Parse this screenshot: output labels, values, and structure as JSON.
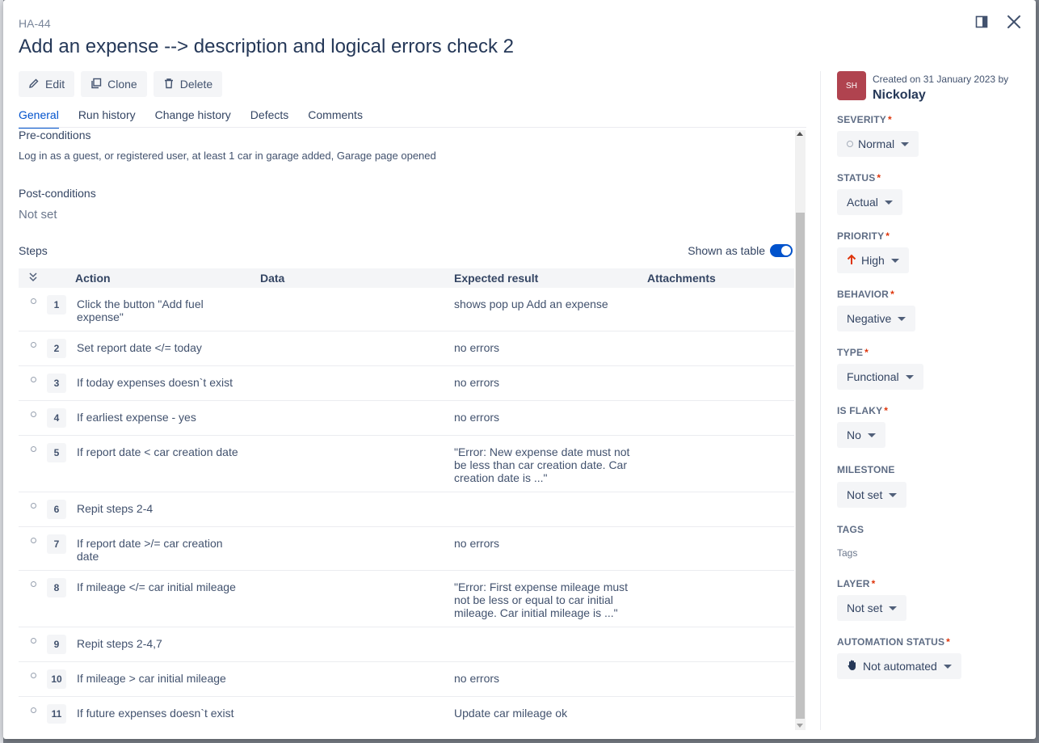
{
  "issue_key": "HA-44",
  "title": "Add an expense --> description and logical errors check 2",
  "toolbar": {
    "edit_label": "Edit",
    "clone_label": "Clone",
    "delete_label": "Delete"
  },
  "tabs": [
    {
      "label": "General",
      "active": true
    },
    {
      "label": "Run history",
      "active": false
    },
    {
      "label": "Change history",
      "active": false
    },
    {
      "label": "Defects",
      "active": false
    },
    {
      "label": "Comments",
      "active": false
    }
  ],
  "preconditions": {
    "label": "Pre-conditions",
    "text": "Log in as a guest, or registered user, at least 1 car in garage added, Garage page opened"
  },
  "postconditions": {
    "label": "Post-conditions",
    "value": "Not set"
  },
  "steps": {
    "label": "Steps",
    "toggle_label": "Shown as table",
    "toggle_on": true,
    "columns": {
      "action": "Action",
      "data": "Data",
      "expected": "Expected result",
      "attachments": "Attachments"
    },
    "rows": [
      {
        "num": "1",
        "action": "Click the button \"Add fuel expense\"",
        "data": "",
        "expected": "shows pop up Add an expense"
      },
      {
        "num": "2",
        "action": "Set report date </= today",
        "data": "",
        "expected": "no errors"
      },
      {
        "num": "3",
        "action": "If today expenses doesn`t exist",
        "data": "",
        "expected": "no errors"
      },
      {
        "num": "4",
        "action": "If earliest expense - yes",
        "data": "",
        "expected": "no errors"
      },
      {
        "num": "5",
        "action": "If report date < car creation date",
        "data": "",
        "expected": "\"Error: New expense date must not be less than car creation date. Car creation date is ...\""
      },
      {
        "num": "6",
        "action": "Repit steps 2-4",
        "data": "",
        "expected": ""
      },
      {
        "num": "7",
        "action": "If report date >/= car creation date",
        "data": "",
        "expected": "no errors"
      },
      {
        "num": "8",
        "action": "If mileage </= car initial mileage",
        "data": "",
        "expected": "\"Error: First expense mileage must not be less or equal to car initial mileage. Car initial mileage is ...\""
      },
      {
        "num": "9",
        "action": "Repit steps 2-4,7",
        "data": "",
        "expected": ""
      },
      {
        "num": "10",
        "action": "If mileage > car initial mileage",
        "data": "",
        "expected": "no errors"
      },
      {
        "num": "11",
        "action": "If future expenses doesn`t exist",
        "data": "",
        "expected": "Update car mileage ok"
      }
    ]
  },
  "sidebar": {
    "avatar_initials": "SH",
    "avatar_color": "#b0434f",
    "created_text": "Created on 31 January 2023 by",
    "author": "Nickolay",
    "severity": {
      "label": "SEVERITY",
      "required": "*",
      "value": "Normal"
    },
    "status": {
      "label": "STATUS",
      "required": "*",
      "value": "Actual"
    },
    "priority": {
      "label": "PRIORITY",
      "required": "*",
      "value": "High"
    },
    "behavior": {
      "label": "BEHAVIOR",
      "required": "*",
      "value": "Negative"
    },
    "type": {
      "label": "TYPE",
      "required": "*",
      "value": "Functional"
    },
    "is_flaky": {
      "label": "IS FLAKY",
      "required": "*",
      "value": "No"
    },
    "milestone": {
      "label": "MILESTONE",
      "value": "Not set"
    },
    "tags": {
      "label": "TAGS",
      "placeholder": "Tags"
    },
    "layer": {
      "label": "LAYER",
      "required": "*",
      "value": "Not set"
    },
    "automation_status": {
      "label": "AUTOMATION STATUS",
      "required": "*",
      "value": "Not automated"
    }
  },
  "colors": {
    "accent": "#0052cc",
    "required": "#de350b",
    "priority_high": "#de350b"
  }
}
